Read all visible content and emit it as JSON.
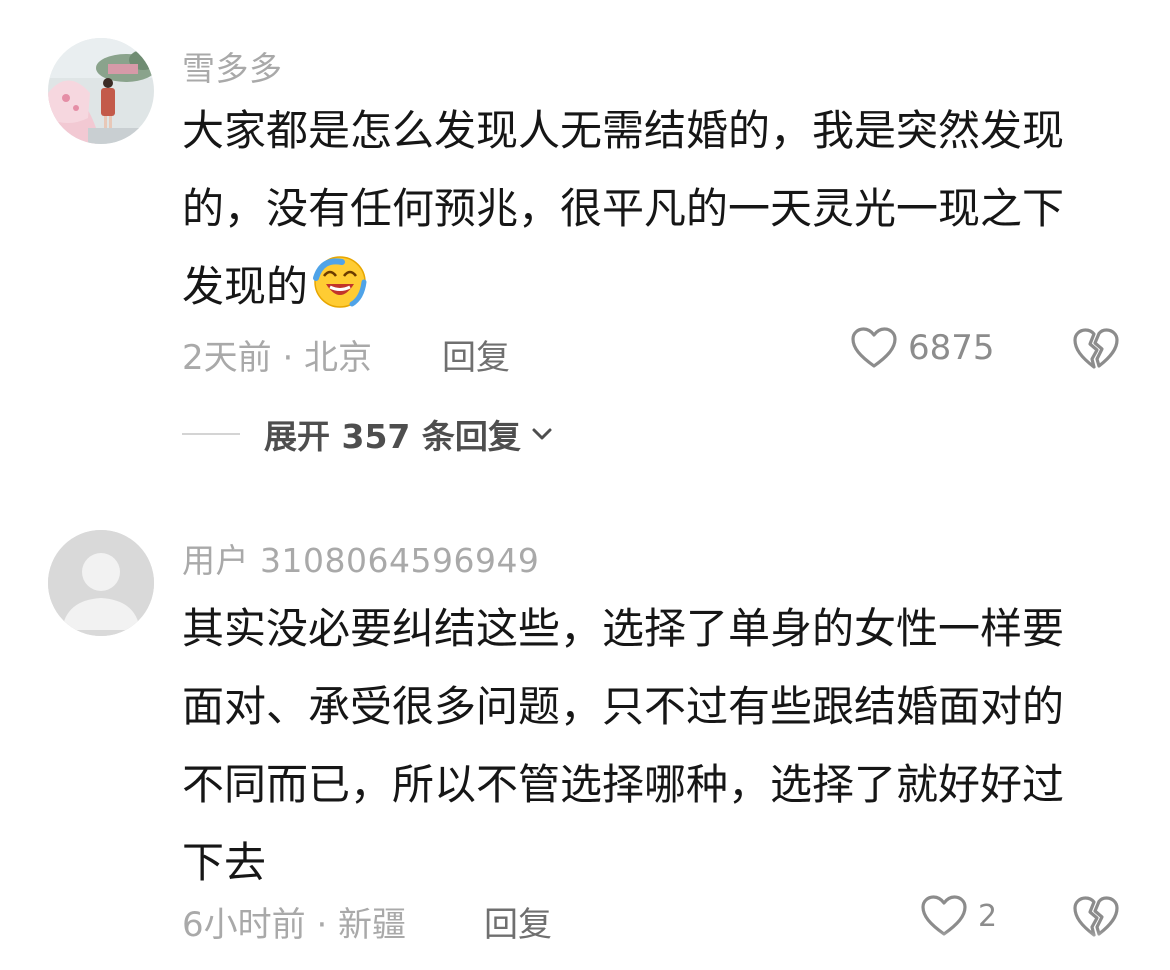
{
  "comments": [
    {
      "username": "雪多多",
      "lines": [
        "大家都是怎么发现人无需结婚的，我是突然发现",
        "的，没有任何预兆，很平凡的一天灵光一现之下",
        "发现的"
      ],
      "emoji": "laughing-crying-face",
      "meta": "2天前 · 北京",
      "reply_label": "回复",
      "likes": "6875",
      "expand_label": "展开 357 条回复"
    },
    {
      "username": "用户 3108064596949",
      "lines": [
        "其实没必要纠结这些，选择了单身的女性一样要",
        "面对、承受很多问题，只不过有些跟结婚面对的",
        "不同而已，所以不管选择哪种，选择了就好好过",
        "下去"
      ],
      "meta": "6小时前 · 新疆",
      "reply_label": "回复",
      "likes": "2"
    }
  ],
  "colors": {
    "username": "#a9a9a9",
    "body_text": "#161616",
    "meta": "#a9a9a9",
    "reply": "#6f6f6f",
    "icon": "#8c8c8c",
    "default_avatar_bg": "#d9d9d9"
  },
  "icons": [
    "heart-outline-icon",
    "broken-heart-icon",
    "chevron-down-icon",
    "laughing-crying-emoji"
  ]
}
